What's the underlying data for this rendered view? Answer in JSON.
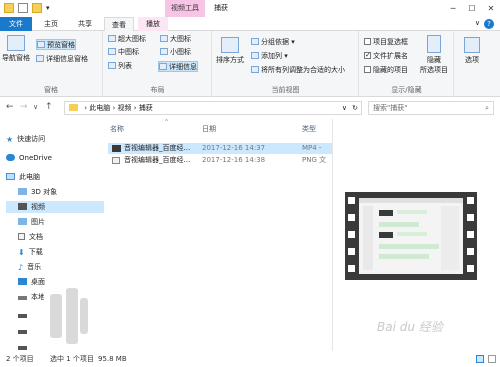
{
  "titlebar": {
    "context_tab": "视频工具",
    "title": "捕获",
    "min": "─",
    "max": "☐",
    "close": "✕"
  },
  "tabs": {
    "file": "文件",
    "home": "主页",
    "share": "共享",
    "view": "查看",
    "play": "播放"
  },
  "ribbon": {
    "panes": {
      "nav_pane": "导航窗格",
      "preview_pane": "预览窗格",
      "details_pane": "详细信息窗格",
      "label": "窗格"
    },
    "layout": {
      "xl_icons": "超大图标",
      "large_icons": "大图标",
      "medium_icons": "中图标",
      "small_icons": "小图标",
      "list": "列表",
      "details": "详细信息",
      "label": "布局"
    },
    "current_view": {
      "sort_by": "排序方式",
      "group_by": "分组依据",
      "add_column": "添加列",
      "fit_columns": "将所有列调整为合适的大小",
      "label": "当前视图"
    },
    "show_hide": {
      "item_checkbox": "项目复选框",
      "file_ext": "文件扩展名",
      "hidden_items": "隐藏的项目",
      "hide": "隐藏",
      "selected_items": "所选项目",
      "label": "显示/隐藏"
    },
    "options": "选项"
  },
  "address": {
    "path": [
      "此电脑",
      "视频",
      "捕获"
    ],
    "search_placeholder": "搜索\"捕获\""
  },
  "nav": {
    "quick_access": "快速访问",
    "onedrive": "OneDrive",
    "this_pc": "此电脑",
    "objects3d": "3D 对象",
    "videos": "视频",
    "pictures": "图片",
    "documents": "文档",
    "downloads": "下载",
    "music": "音乐",
    "desktop": "桌面",
    "local_disk": "本地磁"
  },
  "columns": {
    "name": "名称",
    "date": "日期",
    "type": "类型"
  },
  "files": [
    {
      "name": "音视编辑器_百度经...",
      "date": "2017-12-16 14:37",
      "type": "MP4 -"
    },
    {
      "name": "音视编辑器_百度经...",
      "date": "2017-12-16 14:38",
      "type": "PNG 文"
    }
  ],
  "status": {
    "count": "2 个项目",
    "selected": "选中 1 个项目",
    "size": "95.8 MB"
  },
  "watermark": "Bai du 经验",
  "colors": {
    "accent": "#1979ca",
    "context_tab": "#f7c4e6",
    "selection": "#cce8ff"
  }
}
